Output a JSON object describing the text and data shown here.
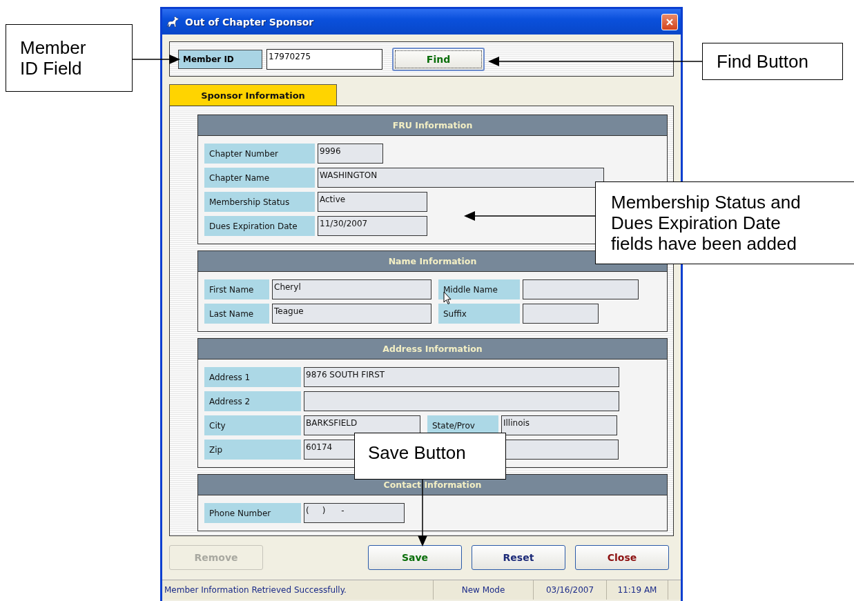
{
  "window": {
    "title": "Out of Chapter Sponsor"
  },
  "search": {
    "label": "Member ID",
    "value": "17970275",
    "button": "Find"
  },
  "tabs": [
    {
      "label": "Sponsor Information",
      "selected": true
    }
  ],
  "sections": [
    {
      "title": "FRU Information",
      "rows": [
        [
          {
            "label": "Chapter Number",
            "value": "9996"
          }
        ],
        [
          {
            "label": "Chapter Name",
            "value": "WASHINGTON"
          }
        ],
        [
          {
            "label": "Membership Status",
            "value": "Active"
          }
        ],
        [
          {
            "label": "Dues Expiration Date",
            "value": "11/30/2007"
          }
        ]
      ]
    },
    {
      "title": "Name Information",
      "rows": [
        [
          {
            "label": "First Name",
            "value": "Cheryl"
          },
          {
            "label": "Middle Name"
          }
        ],
        [
          {
            "label": "Last Name",
            "value": "Teague"
          },
          {
            "label": "Suffix"
          }
        ]
      ]
    },
    {
      "title": "Address Information",
      "rows": [
        [
          {
            "label": "Address 1",
            "value": "9876 SOUTH FIRST"
          }
        ],
        [
          {
            "label": "Address 2"
          }
        ],
        [
          {
            "label": "City",
            "value": "BARKSFIELD"
          },
          {
            "label": "State/Prov",
            "value": "Illinois"
          }
        ],
        [
          {
            "label": "Zip",
            "value": "60174"
          },
          {
            "kind": "covered"
          }
        ]
      ]
    },
    {
      "title": "Contact Information",
      "rows": [
        [
          {
            "label": "Phone Number",
            "value": "(     )      -"
          }
        ]
      ]
    }
  ],
  "buttons": [
    {
      "label": "Remove",
      "disabled": true,
      "color": "#a8a8a0"
    },
    {
      "label": "Save",
      "disabled": false,
      "color": "#0a6e0a"
    },
    {
      "label": "Reset",
      "disabled": false,
      "color": "#1c2a78"
    },
    {
      "label": "Close",
      "disabled": false,
      "color": "#8c1010"
    }
  ],
  "status_bar": [
    "Member Information Retrieved Successfully.",
    "New Mode",
    "03/16/2007",
    "11:19 AM"
  ],
  "callouts": [
    {
      "text": "Member ID Field"
    },
    {
      "text": "Find Button"
    },
    {
      "text": "Membership Status and Dues Expiration Date fields have been added"
    },
    {
      "text": "Save Button"
    }
  ]
}
